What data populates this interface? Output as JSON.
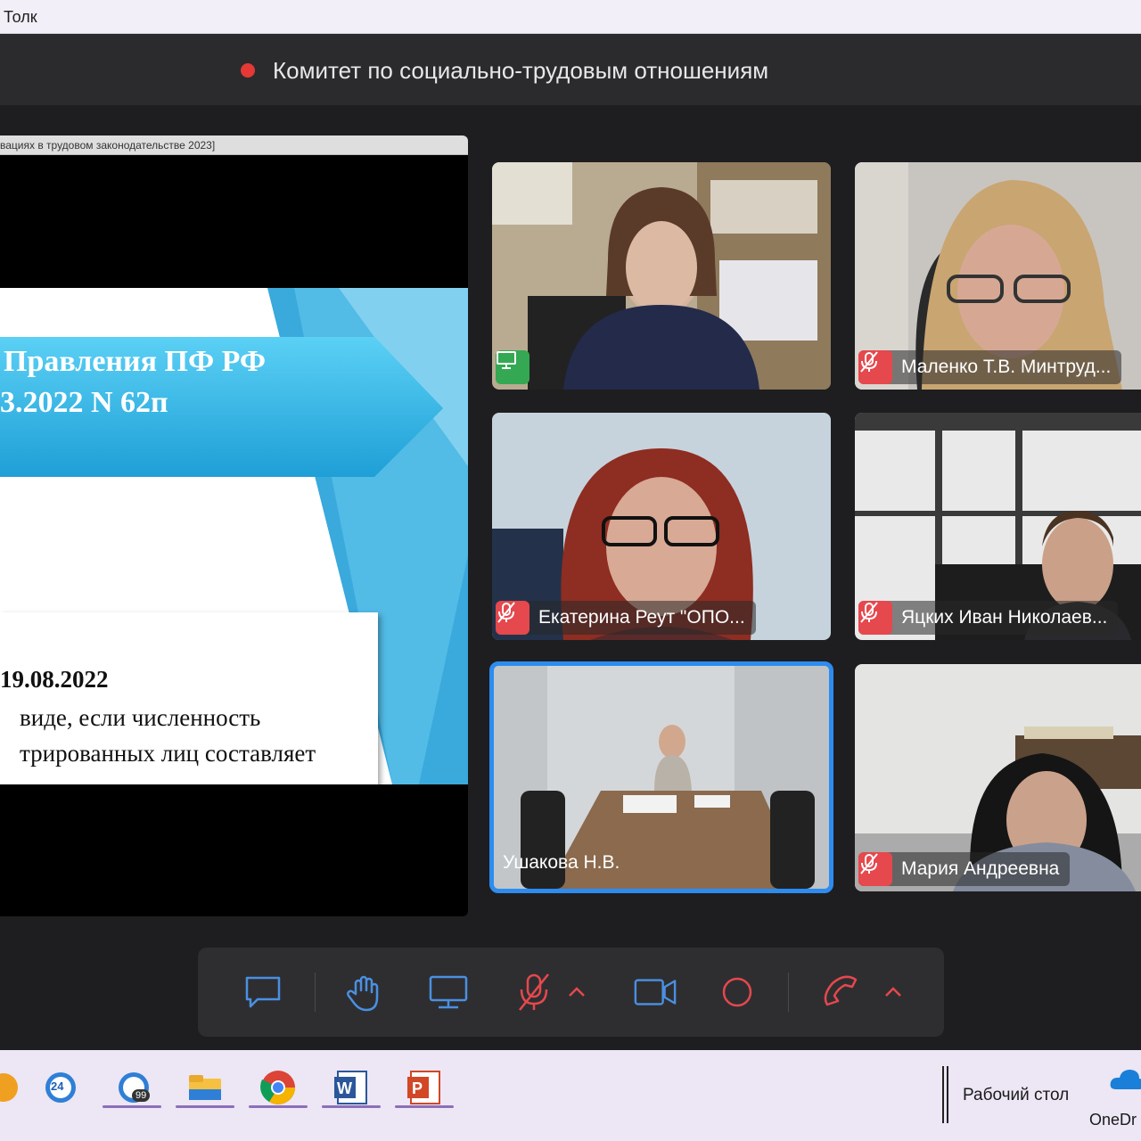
{
  "window": {
    "title": "Толк"
  },
  "meeting": {
    "title": "Комитет по социально-трудовым отношениям",
    "recording_color": "#e53935"
  },
  "presentation": {
    "window_title": "вациях в трудовом законодательстве 2023]",
    "heading_line1": "Правления ПФ РФ",
    "heading_line2": "3.2022 N 62п",
    "body_line1": "19.08.2022",
    "body_line2": "виде,     если     численность",
    "body_line3": "трированных лиц составляет"
  },
  "participants": [
    {
      "name": "",
      "status_icon": "screen-share-icon",
      "active": false
    },
    {
      "name": "Маленко Т.В. Минтруд...",
      "status_icon": "mic-off-icon",
      "active": false
    },
    {
      "name": "Екатерина Реут \"ОПО...",
      "status_icon": "mic-off-icon",
      "active": false
    },
    {
      "name": "Яцких Иван Николаев...",
      "status_icon": "mic-off-icon",
      "active": false
    },
    {
      "name": "Ушакова Н.В.",
      "status_icon": "",
      "active": true
    },
    {
      "name": "Мария Андреевна",
      "status_icon": "mic-off-icon",
      "active": false
    }
  ],
  "toolbar": {
    "buttons": [
      "chat-icon",
      "raise-hand-icon",
      "screen-share-icon",
      "mic-off-icon",
      "camera-icon",
      "record-icon",
      "end-call-icon"
    ],
    "accent_color": "#e5484d",
    "icon_color": "#4a90e2"
  },
  "taskbar": {
    "badge_24": "24",
    "badge_99": "99",
    "desktop_label": "Рабочий стол",
    "onedrive_label": "OneDr"
  }
}
